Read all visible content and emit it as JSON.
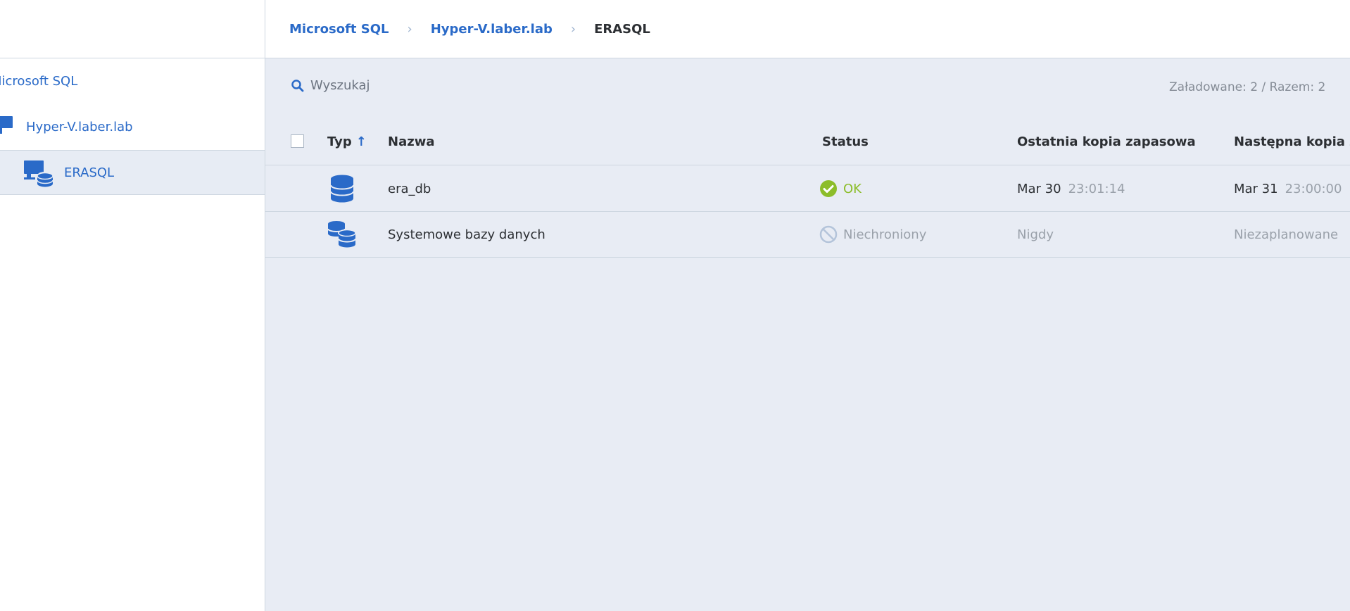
{
  "breadcrumb": {
    "items": [
      "Microsoft SQL",
      "Hyper-V.laber.lab",
      "ERASQL"
    ],
    "separator": "›"
  },
  "sidebar": {
    "items": [
      {
        "label": "Microsoft SQL"
      },
      {
        "label": "Hyper-V.laber.lab",
        "icon": "monitor-icon"
      },
      {
        "label": "ERASQL",
        "icon": "sql-server-icon",
        "selected": true
      }
    ]
  },
  "toolbar": {
    "search_placeholder": "Wyszukaj",
    "counts": "Załadowane: 2 / Razem: 2"
  },
  "table": {
    "columns": [
      "Typ",
      "Nazwa",
      "Status",
      "Ostatnia kopia zapasowa",
      "Następna kopia za"
    ],
    "sort_indicator": "↑",
    "rows": [
      {
        "type_icon": "database-icon",
        "name": "era_db",
        "status": "OK",
        "status_icon": "check-circle-icon",
        "last_backup_date": "Mar 30",
        "last_backup_time": "23:01:14",
        "next_backup_date": "Mar 31",
        "next_backup_time": "23:00:00"
      },
      {
        "type_icon": "databases-icon",
        "name": "Systemowe bazy danych",
        "status": "Niechroniony",
        "status_icon": "prohibited-icon",
        "last_backup": "Nigdy",
        "next_backup": "Niezaplanowane"
      }
    ]
  },
  "colors": {
    "link": "#2a6ac8",
    "ok": "#8cbd2a",
    "muted": "#9aa1aa",
    "main_bg": "#e8ecf4",
    "selected_bg": "#e7ecf4"
  }
}
